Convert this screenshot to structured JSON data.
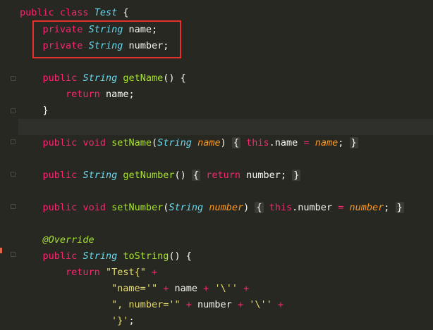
{
  "code": {
    "class_decl": {
      "kw1": "public",
      "kw2": "class",
      "name": "Test",
      "brace": "{"
    },
    "field1": {
      "kw": "private",
      "type": "String",
      "name": "name",
      "semi": ";"
    },
    "field2": {
      "kw": "private",
      "type": "String",
      "name": "number",
      "semi": ";"
    },
    "getName": {
      "kw": "public",
      "type": "String",
      "name": "getName",
      "params": "()",
      "brace": "{"
    },
    "getName_body": {
      "kw": "return",
      "val": "name",
      "semi": ";"
    },
    "getName_close": "}",
    "setName": {
      "kw1": "public",
      "kw2": "void",
      "name": "setName",
      "lp": "(",
      "ptype": "String",
      "pname": "name",
      "rp": ")",
      "ob": "{",
      "this": "this",
      "field": ".name",
      "eq": "=",
      "val": "name",
      "semi": ";",
      "cb": "}"
    },
    "getNumber": {
      "kw": "public",
      "type": "String",
      "name": "getNumber",
      "params": "()",
      "ob": "{",
      "ret": "return",
      "val": "number",
      "semi": ";",
      "cb": "}"
    },
    "setNumber": {
      "kw1": "public",
      "kw2": "void",
      "name": "setNumber",
      "lp": "(",
      "ptype": "String",
      "pname": "number",
      "rp": ")",
      "ob": "{",
      "this": "this",
      "field": ".number",
      "eq": "=",
      "val": "number",
      "semi": ";",
      "cb": "}"
    },
    "annotation": "@Override",
    "toString": {
      "kw": "public",
      "type": "String",
      "name": "toString",
      "params": "()",
      "brace": "{"
    },
    "ts1": {
      "kw": "return",
      "str": "\"Test{\"",
      "plus": "+"
    },
    "ts2": {
      "str1": "\"name='\"",
      "plus1": "+",
      "val": "name",
      "plus2": "+",
      "str2": "'\\''",
      "plus3": "+"
    },
    "ts3": {
      "str1": "\", number='\"",
      "plus1": "+",
      "val": "number",
      "plus2": "+",
      "str2": "'\\''",
      "plus3": "+"
    },
    "ts4": {
      "str": "'}'",
      "semi": ";"
    }
  }
}
